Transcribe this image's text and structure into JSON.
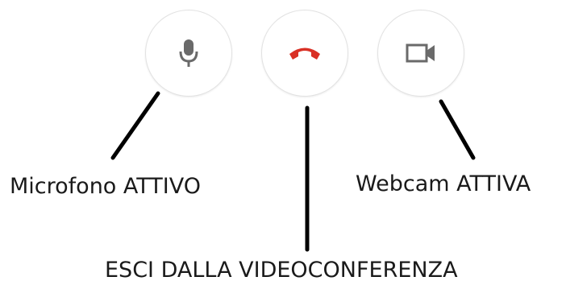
{
  "controls": {
    "microphone": {
      "icon": "microphone-icon",
      "label": "Microfono ATTIVO",
      "color": "#6a6a6a"
    },
    "hangup": {
      "icon": "hang-up-phone-icon",
      "label": "ESCI DALLA VIDEOCONFERENZA",
      "color": "#d93025"
    },
    "webcam": {
      "icon": "video-camera-icon",
      "label": "Webcam ATTIVA",
      "color": "#6a6a6a"
    }
  },
  "colors": {
    "button_border": "#e2e2e2",
    "pointer_line": "#000000",
    "text": "#1a1a1a"
  }
}
